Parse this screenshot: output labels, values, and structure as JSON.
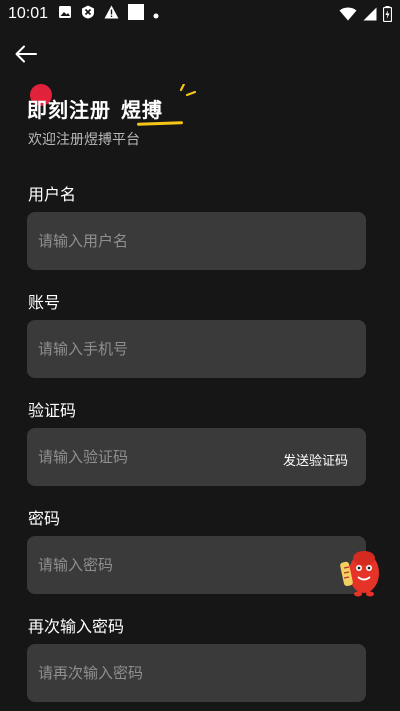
{
  "status_bar": {
    "time": "10:01",
    "icons": [
      "image-icon",
      "close-circle-icon",
      "warning-icon",
      "square-icon",
      "dot-icon"
    ],
    "right_icons": [
      "wifi-icon",
      "signal-icon",
      "battery-charging-icon"
    ]
  },
  "header": {
    "back_icon": "arrow-left-icon",
    "title_main": "即刻注册",
    "title_brand": "煜搏",
    "subtitle": "欢迎注册煜搏平台",
    "accent_dot_color": "#e2223b",
    "accent_underline_color": "#f5c518"
  },
  "form": {
    "username": {
      "label": "用户名",
      "placeholder": "请输入用户名",
      "value": ""
    },
    "account": {
      "label": "账号",
      "placeholder": "请输入手机号",
      "value": ""
    },
    "code": {
      "label": "验证码",
      "placeholder": "请输入验证码",
      "value": "",
      "send_label": "发送验证码"
    },
    "password": {
      "label": "密码",
      "placeholder": "请输入密码",
      "value": ""
    },
    "confirm_password": {
      "label": "再次输入密码",
      "placeholder": "请再次输入密码",
      "value": ""
    }
  },
  "floating": {
    "icon": "mascot-icon"
  },
  "colors": {
    "background": "#161616",
    "input_bg": "#3a3a3a",
    "placeholder": "#8f8f8f"
  }
}
